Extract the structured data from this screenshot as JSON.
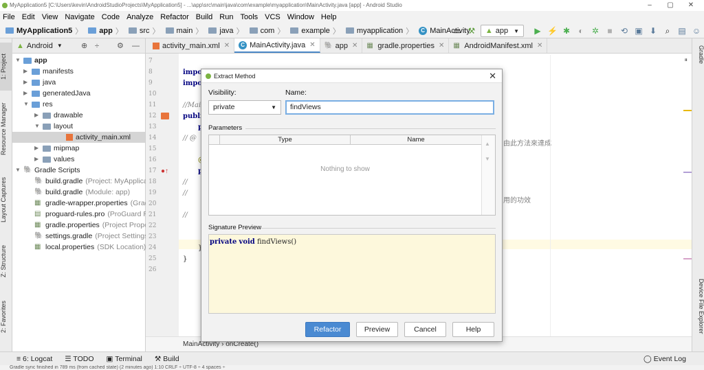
{
  "window": {
    "title": "MyApplication5 [C:\\Users\\kevin\\AndroidStudioProjects\\MyApplication5] - ...\\app\\src\\main\\java\\com\\example\\myapplication\\MainActivity.java [app] - Android Studio",
    "controls": [
      "–",
      "▢",
      "✕"
    ]
  },
  "menu": [
    "File",
    "Edit",
    "View",
    "Navigate",
    "Code",
    "Analyze",
    "Refactor",
    "Build",
    "Run",
    "Tools",
    "VCS",
    "Window",
    "Help"
  ],
  "nav": {
    "crumbs": [
      "MyApplication5",
      "app",
      "src",
      "main",
      "java",
      "com",
      "example",
      "myapplication",
      "MainActivity"
    ],
    "run_config": "app"
  },
  "left_tabs": [
    "1: Project",
    "Resource Manager",
    "Layout Captures",
    "Z: Structure",
    "2: Favorites"
  ],
  "right_tabs": [
    "Gradle",
    "Device File Explorer"
  ],
  "project": {
    "view_mode": "Android",
    "tree": [
      {
        "label": "app",
        "gray": ""
      },
      {
        "label": "manifests",
        "gray": ""
      },
      {
        "label": "java",
        "gray": ""
      },
      {
        "label": "generatedJava",
        "gray": ""
      },
      {
        "label": "res",
        "gray": ""
      },
      {
        "label": "drawable",
        "gray": ""
      },
      {
        "label": "layout",
        "gray": ""
      },
      {
        "label": "activity_main.xml",
        "gray": ""
      },
      {
        "label": "mipmap",
        "gray": ""
      },
      {
        "label": "values",
        "gray": ""
      },
      {
        "label": "Gradle Scripts",
        "gray": ""
      },
      {
        "label": "build.gradle",
        "gray": "(Project: MyApplica"
      },
      {
        "label": "build.gradle",
        "gray": "(Module: app)"
      },
      {
        "label": "gradle-wrapper.properties",
        "gray": "(Grad"
      },
      {
        "label": "proguard-rules.pro",
        "gray": "(ProGuard R"
      },
      {
        "label": "gradle.properties",
        "gray": "(Project Prope"
      },
      {
        "label": "settings.gradle",
        "gray": "(Project Settings"
      },
      {
        "label": "local.properties",
        "gray": "(SDK Location)"
      }
    ]
  },
  "editor": {
    "tabs": [
      "activity_main.xml",
      "MainActivity.java",
      "app",
      "gradle.properties",
      "AndroidManifest.xml"
    ],
    "line_numbers": [
      "7",
      "8",
      "9",
      "10",
      "11",
      "12",
      "13",
      "14",
      "15",
      "16",
      "17",
      "18",
      "19",
      "20",
      "21",
      "22",
      "23",
      "24",
      "25",
      "26"
    ],
    "code": {
      "l8": "import",
      "l9": "import",
      "l11": "//Main",
      "l12": "public",
      "l13": "p",
      "l14": "//  @",
      "l16": "@",
      "l17": "p",
      "l18": "//",
      "l19": "//",
      "l21": "//",
      "l24": "}",
      "l25": "}"
    },
    "comment_tail_1": "由此方法來達成",
    "comment_tail_2": "用的功效",
    "breadcrumb": "MainActivity  ›  onCreate()"
  },
  "dialog": {
    "title": "Extract Method",
    "visibility_label": "Visibility:",
    "visibility_value": "private",
    "name_label": "Name:",
    "name_value": "findViews",
    "parameters_label": "Parameters",
    "col_type": "Type",
    "col_name": "Name",
    "empty_text": "Nothing to show",
    "signature_label": "Signature Preview",
    "signature_kw1": "private",
    "signature_kw2": "void",
    "signature_rest": "findViews()",
    "buttons": {
      "refactor": "Refactor",
      "preview": "Preview",
      "cancel": "Cancel",
      "help": "Help"
    }
  },
  "bottom_tools": [
    "6: Logcat",
    "TODO",
    "Terminal",
    "Build",
    "Event Log"
  ],
  "status": "Gradle sync finished in 789 ms (from cached state) (2 minutes ago)      1:10   CRLF ÷   UTF-8 ÷   4 spaces ÷"
}
